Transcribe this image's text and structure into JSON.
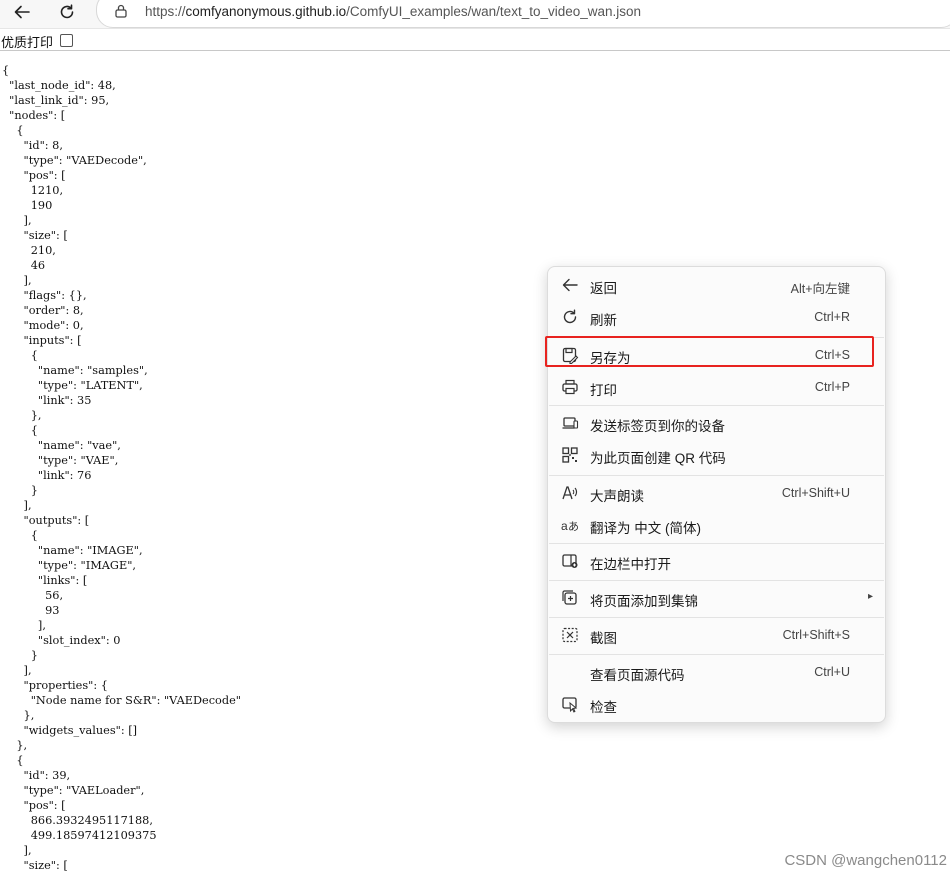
{
  "browser": {
    "url_prefix": "https://",
    "url_host": "comfyanonymous.github.io",
    "url_path": "/ComfyUI_examples/wan/text_to_video_wan.json",
    "icons": {
      "back": "back-arrow-icon",
      "refresh": "refresh-icon",
      "lock": "lock-icon"
    }
  },
  "print_bar": {
    "label": "优质打印",
    "checked": false
  },
  "json_text": "{\n  \"last_node_id\": 48,\n  \"last_link_id\": 95,\n  \"nodes\": [\n    {\n      \"id\": 8,\n      \"type\": \"VAEDecode\",\n      \"pos\": [\n        1210,\n        190\n      ],\n      \"size\": [\n        210,\n        46\n      ],\n      \"flags\": {},\n      \"order\": 8,\n      \"mode\": 0,\n      \"inputs\": [\n        {\n          \"name\": \"samples\",\n          \"type\": \"LATENT\",\n          \"link\": 35\n        },\n        {\n          \"name\": \"vae\",\n          \"type\": \"VAE\",\n          \"link\": 76\n        }\n      ],\n      \"outputs\": [\n        {\n          \"name\": \"IMAGE\",\n          \"type\": \"IMAGE\",\n          \"links\": [\n            56,\n            93\n          ],\n          \"slot_index\": 0\n        }\n      ],\n      \"properties\": {\n        \"Node name for S&R\": \"VAEDecode\"\n      },\n      \"widgets_values\": []\n    },\n    {\n      \"id\": 39,\n      \"type\": \"VAELoader\",\n      \"pos\": [\n        866.3932495117188,\n        499.18597412109375\n      ],\n      \"size\": [",
  "context_menu": {
    "items": [
      {
        "label": "返回",
        "shortcut": "Alt+向左键",
        "icon": "back-icon"
      },
      {
        "label": "刷新",
        "shortcut": "Ctrl+R",
        "icon": "refresh-icon"
      },
      {
        "label": "另存为",
        "shortcut": "Ctrl+S",
        "icon": "save-icon",
        "highlighted": true
      },
      {
        "label": "打印",
        "shortcut": "Ctrl+P",
        "icon": "print-icon"
      },
      {
        "label": "发送标签页到你的设备",
        "shortcut": "",
        "icon": "send-device-icon"
      },
      {
        "label": "为此页面创建 QR 代码",
        "shortcut": "",
        "icon": "qr-code-icon"
      },
      {
        "label": "大声朗读",
        "shortcut": "Ctrl+Shift+U",
        "icon": "read-aloud-icon"
      },
      {
        "label": "翻译为 中文 (简体)",
        "shortcut": "",
        "icon": "translate-icon"
      },
      {
        "label": "在边栏中打开",
        "shortcut": "",
        "icon": "sidebar-icon"
      },
      {
        "label": "将页面添加到集锦",
        "shortcut": "",
        "icon": "collections-icon",
        "submenu": "▸"
      },
      {
        "label": "截图",
        "shortcut": "Ctrl+Shift+S",
        "icon": "screenshot-icon"
      },
      {
        "label": "查看页面源代码",
        "shortcut": "Ctrl+U",
        "icon": ""
      },
      {
        "label": "检查",
        "shortcut": "",
        "icon": "inspect-icon"
      }
    ],
    "highlight_color": "#e8231f"
  },
  "watermark": "CSDN @wangchen0112"
}
